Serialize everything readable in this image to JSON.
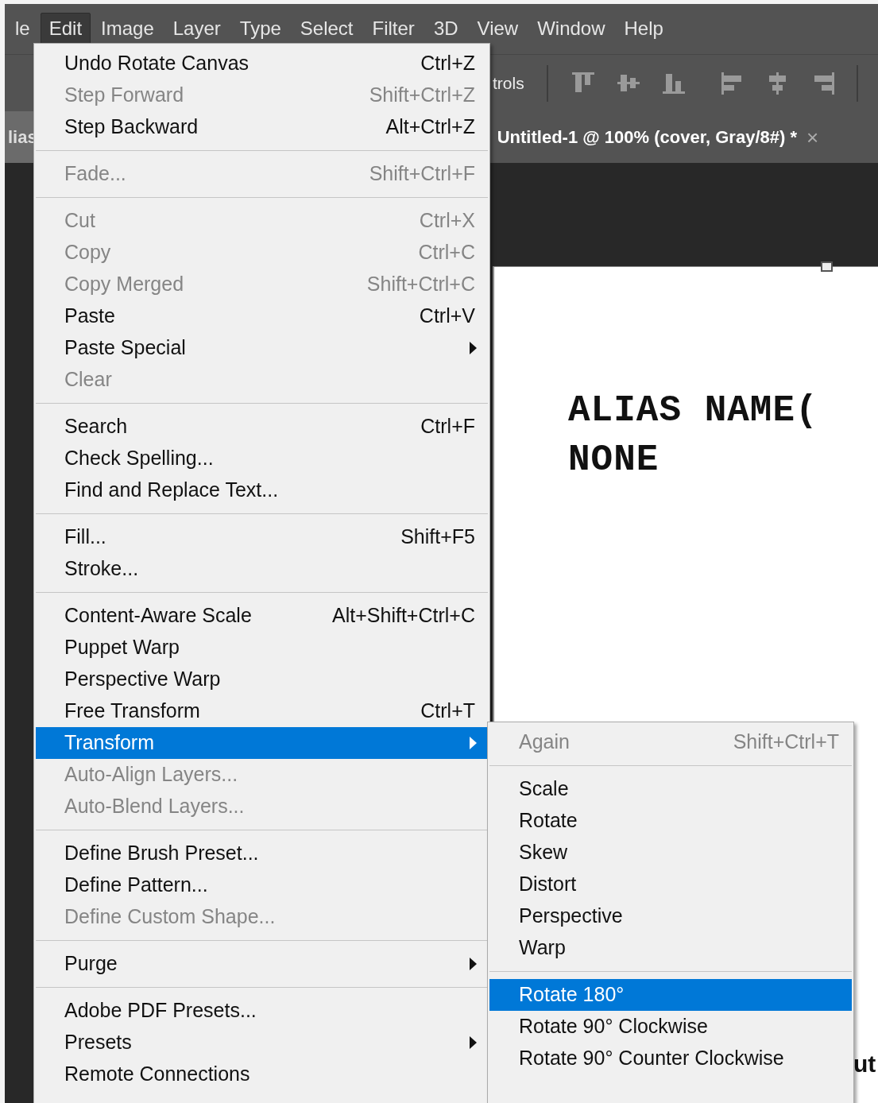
{
  "menu_bar": [
    {
      "label": "le",
      "selected": false
    },
    {
      "label": "Edit",
      "selected": true
    },
    {
      "label": "Image",
      "selected": false
    },
    {
      "label": "Layer",
      "selected": false
    },
    {
      "label": "Type",
      "selected": false
    },
    {
      "label": "Select",
      "selected": false
    },
    {
      "label": "Filter",
      "selected": false
    },
    {
      "label": "3D",
      "selected": false
    },
    {
      "label": "View",
      "selected": false
    },
    {
      "label": "Window",
      "selected": false
    },
    {
      "label": "Help",
      "selected": false
    }
  ],
  "options_bar": {
    "label": "trols"
  },
  "tabs": [
    {
      "label": "lias",
      "selected": false
    },
    {
      "label": "Untitled-1 @ 100% (cover, Gray/8#) *",
      "selected": true,
      "close": "×"
    }
  ],
  "document": {
    "lines": [
      "ALIAS NAME(",
      "NONE"
    ],
    "corner_text": "ut"
  },
  "edit_menu": [
    {
      "kind": "item",
      "label": "Undo Rotate Canvas",
      "shortcut": "Ctrl+Z",
      "disabled": false,
      "selected": false,
      "submenu": false
    },
    {
      "kind": "item",
      "label": "Step Forward",
      "shortcut": "Shift+Ctrl+Z",
      "disabled": true,
      "selected": false,
      "submenu": false
    },
    {
      "kind": "item",
      "label": "Step Backward",
      "shortcut": "Alt+Ctrl+Z",
      "disabled": false,
      "selected": false,
      "submenu": false
    },
    {
      "kind": "separator"
    },
    {
      "kind": "item",
      "label": "Fade...",
      "shortcut": "Shift+Ctrl+F",
      "disabled": true,
      "selected": false,
      "submenu": false
    },
    {
      "kind": "separator"
    },
    {
      "kind": "item",
      "label": "Cut",
      "shortcut": "Ctrl+X",
      "disabled": true,
      "selected": false,
      "submenu": false
    },
    {
      "kind": "item",
      "label": "Copy",
      "shortcut": "Ctrl+C",
      "disabled": true,
      "selected": false,
      "submenu": false
    },
    {
      "kind": "item",
      "label": "Copy Merged",
      "shortcut": "Shift+Ctrl+C",
      "disabled": true,
      "selected": false,
      "submenu": false
    },
    {
      "kind": "item",
      "label": "Paste",
      "shortcut": "Ctrl+V",
      "disabled": false,
      "selected": false,
      "submenu": false
    },
    {
      "kind": "item",
      "label": "Paste Special",
      "disabled": false,
      "selected": false,
      "submenu": true
    },
    {
      "kind": "item",
      "label": "Clear",
      "disabled": true,
      "selected": false,
      "submenu": false
    },
    {
      "kind": "separator"
    },
    {
      "kind": "item",
      "label": "Search",
      "shortcut": "Ctrl+F",
      "disabled": false,
      "selected": false,
      "submenu": false
    },
    {
      "kind": "item",
      "label": "Check Spelling...",
      "disabled": false,
      "selected": false,
      "submenu": false
    },
    {
      "kind": "item",
      "label": "Find and Replace Text...",
      "disabled": false,
      "selected": false,
      "submenu": false
    },
    {
      "kind": "separator"
    },
    {
      "kind": "item",
      "label": "Fill...",
      "shortcut": "Shift+F5",
      "disabled": false,
      "selected": false,
      "submenu": false
    },
    {
      "kind": "item",
      "label": "Stroke...",
      "disabled": false,
      "selected": false,
      "submenu": false
    },
    {
      "kind": "separator"
    },
    {
      "kind": "item",
      "label": "Content-Aware Scale",
      "shortcut": "Alt+Shift+Ctrl+C",
      "disabled": false,
      "selected": false,
      "submenu": false
    },
    {
      "kind": "item",
      "label": "Puppet Warp",
      "disabled": false,
      "selected": false,
      "submenu": false
    },
    {
      "kind": "item",
      "label": "Perspective Warp",
      "disabled": false,
      "selected": false,
      "submenu": false
    },
    {
      "kind": "item",
      "label": "Free Transform",
      "shortcut": "Ctrl+T",
      "disabled": false,
      "selected": false,
      "submenu": false
    },
    {
      "kind": "item",
      "label": "Transform",
      "disabled": false,
      "selected": true,
      "submenu": true
    },
    {
      "kind": "item",
      "label": "Auto-Align Layers...",
      "disabled": true,
      "selected": false,
      "submenu": false
    },
    {
      "kind": "item",
      "label": "Auto-Blend Layers...",
      "disabled": true,
      "selected": false,
      "submenu": false
    },
    {
      "kind": "separator"
    },
    {
      "kind": "item",
      "label": "Define Brush Preset...",
      "disabled": false,
      "selected": false,
      "submenu": false
    },
    {
      "kind": "item",
      "label": "Define Pattern...",
      "disabled": false,
      "selected": false,
      "submenu": false
    },
    {
      "kind": "item",
      "label": "Define Custom Shape...",
      "disabled": true,
      "selected": false,
      "submenu": false
    },
    {
      "kind": "separator"
    },
    {
      "kind": "item",
      "label": "Purge",
      "disabled": false,
      "selected": false,
      "submenu": true
    },
    {
      "kind": "separator"
    },
    {
      "kind": "item",
      "label": "Adobe PDF Presets...",
      "disabled": false,
      "selected": false,
      "submenu": false
    },
    {
      "kind": "item",
      "label": "Presets",
      "disabled": false,
      "selected": false,
      "submenu": true
    },
    {
      "kind": "item",
      "label": "Remote Connections",
      "disabled": false,
      "selected": false,
      "submenu": false
    }
  ],
  "transform_submenu": [
    {
      "kind": "item",
      "label": "Again",
      "shortcut": "Shift+Ctrl+T",
      "disabled": true,
      "selected": false,
      "submenu": false
    },
    {
      "kind": "separator"
    },
    {
      "kind": "item",
      "label": "Scale",
      "disabled": false,
      "selected": false,
      "submenu": false
    },
    {
      "kind": "item",
      "label": "Rotate",
      "disabled": false,
      "selected": false,
      "submenu": false
    },
    {
      "kind": "item",
      "label": "Skew",
      "disabled": false,
      "selected": false,
      "submenu": false
    },
    {
      "kind": "item",
      "label": "Distort",
      "disabled": false,
      "selected": false,
      "submenu": false
    },
    {
      "kind": "item",
      "label": "Perspective",
      "disabled": false,
      "selected": false,
      "submenu": false
    },
    {
      "kind": "item",
      "label": "Warp",
      "disabled": false,
      "selected": false,
      "submenu": false
    },
    {
      "kind": "separator"
    },
    {
      "kind": "item",
      "label": "Rotate 180°",
      "disabled": false,
      "selected": true,
      "submenu": false
    },
    {
      "kind": "item",
      "label": "Rotate 90° Clockwise",
      "disabled": false,
      "selected": false,
      "submenu": false
    },
    {
      "kind": "item",
      "label": "Rotate 90° Counter Clockwise",
      "disabled": false,
      "selected": false,
      "submenu": false
    }
  ]
}
